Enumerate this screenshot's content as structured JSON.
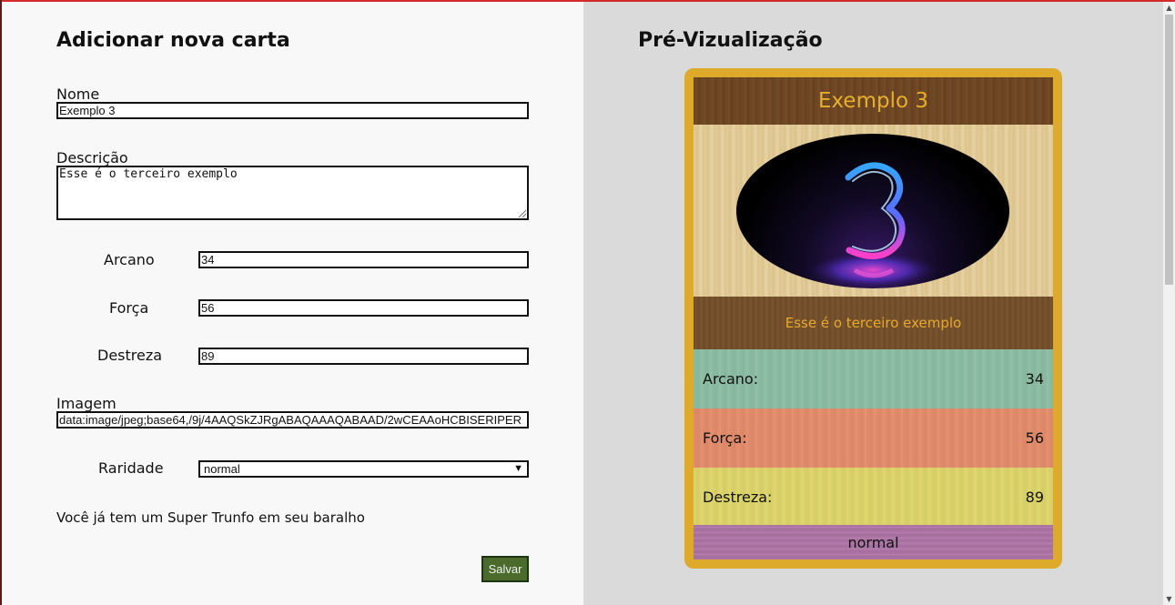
{
  "form": {
    "title": "Adicionar nova carta",
    "name_label": "Nome",
    "name_value": "Exemplo 3",
    "description_label": "Descrição",
    "description_value": "Esse é o terceiro exemplo",
    "arcano_label": "Arcano",
    "arcano_value": "34",
    "forca_label": "Força",
    "forca_value": "56",
    "destreza_label": "Destreza",
    "destreza_value": "89",
    "image_label": "Imagem",
    "image_value": "data:image/jpeg;base64,/9j/4AAQSkZJRgABAQAAAQABAAD/2wCEAAoHCBISERIPER",
    "rarity_label": "Raridade",
    "rarity_value": "normal",
    "trunfo_message": "Você já tem um Super Trunfo em seu baralho",
    "save_label": "Salvar"
  },
  "preview": {
    "title": "Pré-Vizualização",
    "card": {
      "name": "Exemplo 3",
      "image_icon": "neon-number-3-image",
      "description": "Esse é o terceiro exemplo",
      "stats": [
        {
          "label": "Arcano:",
          "value": "34"
        },
        {
          "label": "Força:",
          "value": "56"
        },
        {
          "label": "Destreza:",
          "value": "89"
        }
      ],
      "rarity": "normal"
    }
  },
  "colors": {
    "accent_top": "#d42a2a",
    "card_border": "#ddaa2c",
    "save_button": "#4a6b2c"
  }
}
